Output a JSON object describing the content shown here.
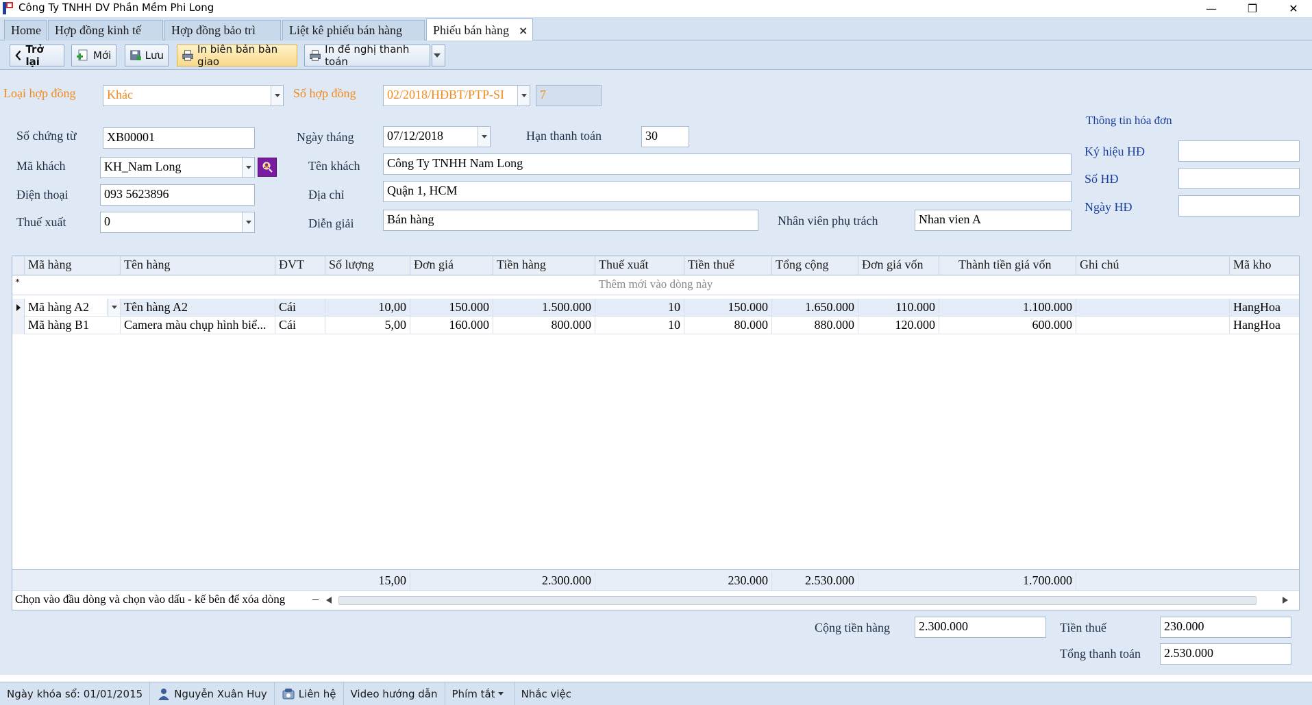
{
  "window": {
    "title": "Công Ty TNHH DV Phần Mềm Phi Long",
    "minimize": "—",
    "restore": "❐",
    "close": "✕"
  },
  "tabs": [
    {
      "label": "Home"
    },
    {
      "label": "Hợp đồng kinh tế"
    },
    {
      "label": "Hợp đồng bảo trì"
    },
    {
      "label": "Liệt kê phiếu bán hàng"
    },
    {
      "label": "Phiếu bán hàng",
      "active": true
    }
  ],
  "toolbar": {
    "back": "Trở lại",
    "new": "Mới",
    "save": "Lưu",
    "print_handover": "In biên bản bàn giao",
    "print_payment": "In đề nghị thanh toán"
  },
  "form": {
    "contract_type_label": "Loại hợp đồng",
    "contract_type_value": "Khác",
    "contract_no_label": "Số hợp đồng",
    "contract_no_value": "02/2018/HĐBT/PTP-SI",
    "contract_no_extra": "7",
    "voucher_no_label": "Số chứng từ",
    "voucher_no_value": "XB00001",
    "date_label": "Ngày tháng",
    "date_value": "07/12/2018",
    "due_label": "Hạn thanh toán",
    "due_value": "30",
    "customer_code_label": "Mã khách",
    "customer_code_value": "KH_Nam Long",
    "customer_name_label": "Tên khách",
    "customer_name_value": "Công Ty TNHH Nam Long",
    "phone_label": "Điện thoại",
    "phone_value": "093 5623896",
    "address_label": "Địa chỉ",
    "address_value": "Quận 1, HCM",
    "tax_label": "Thuế xuất",
    "tax_value": "0",
    "desc_label": "Diễn giải",
    "desc_value": "Bán hàng",
    "staff_label": "Nhân viên phụ trách",
    "staff_value": "Nhan vien A"
  },
  "invoice": {
    "title": "Thông tin hóa đơn",
    "symbol_label": "Ký hiệu HĐ",
    "symbol_value": "",
    "number_label": "Số HĐ",
    "number_value": "",
    "date_label": "Ngày HĐ",
    "date_value": ""
  },
  "grid": {
    "columns": [
      "Mã hàng",
      "Tên hàng",
      "ĐVT",
      "Số lượng",
      "Đơn giá",
      "Tiền hàng",
      "Thuế xuất",
      "Tiền thuế",
      "Tổng cộng",
      "Đơn giá vốn",
      "Thành tiền giá vốn",
      "Ghi chú",
      "Mã kho"
    ],
    "new_row_text": "Thêm mới vào dòng này",
    "rows": [
      {
        "ma_hang": "Mã hàng A2",
        "ten_hang": "Tên hàng A2",
        "dvt": "Cái",
        "so_luong": "10,00",
        "don_gia": "150.000",
        "tien_hang": "1.500.000",
        "thue_xuat": "10",
        "tien_thue": "150.000",
        "tong_cong": "1.650.000",
        "don_gia_von": "110.000",
        "thanh_tien_von": "1.100.000",
        "ghi_chu": "",
        "ma_kho": "HangHoa"
      },
      {
        "ma_hang": "Mã hàng B1",
        "ten_hang": "Camera màu chụp hình biể...",
        "dvt": "Cái",
        "so_luong": "5,00",
        "don_gia": "160.000",
        "tien_hang": "800.000",
        "thue_xuat": "10",
        "tien_thue": "80.000",
        "tong_cong": "880.000",
        "don_gia_von": "120.000",
        "thanh_tien_von": "600.000",
        "ghi_chu": "",
        "ma_kho": "HangHoa"
      }
    ],
    "totals": {
      "so_luong": "15,00",
      "tien_hang": "2.300.000",
      "tien_thue": "230.000",
      "tong_cong": "2.530.000",
      "thanh_tien_von": "1.700.000"
    },
    "hint": "Chọn vào đầu dòng và chọn vào dấu - kế bên để xóa dòng"
  },
  "summary": {
    "subtotal_label": "Cộng tiền hàng",
    "subtotal_value": "2.300.000",
    "tax_label": "Tiền thuế",
    "tax_value": "230.000",
    "total_label": "Tổng thanh toán",
    "total_value": "2.530.000"
  },
  "statusbar": {
    "lock_date": "Ngày khóa sổ: 01/01/2015",
    "user": "Nguyễn Xuân Huy",
    "contact": "Liên hệ",
    "video": "Video hướng dẫn",
    "shortcuts": "Phím tắt",
    "reminder": "Nhắc việc"
  }
}
